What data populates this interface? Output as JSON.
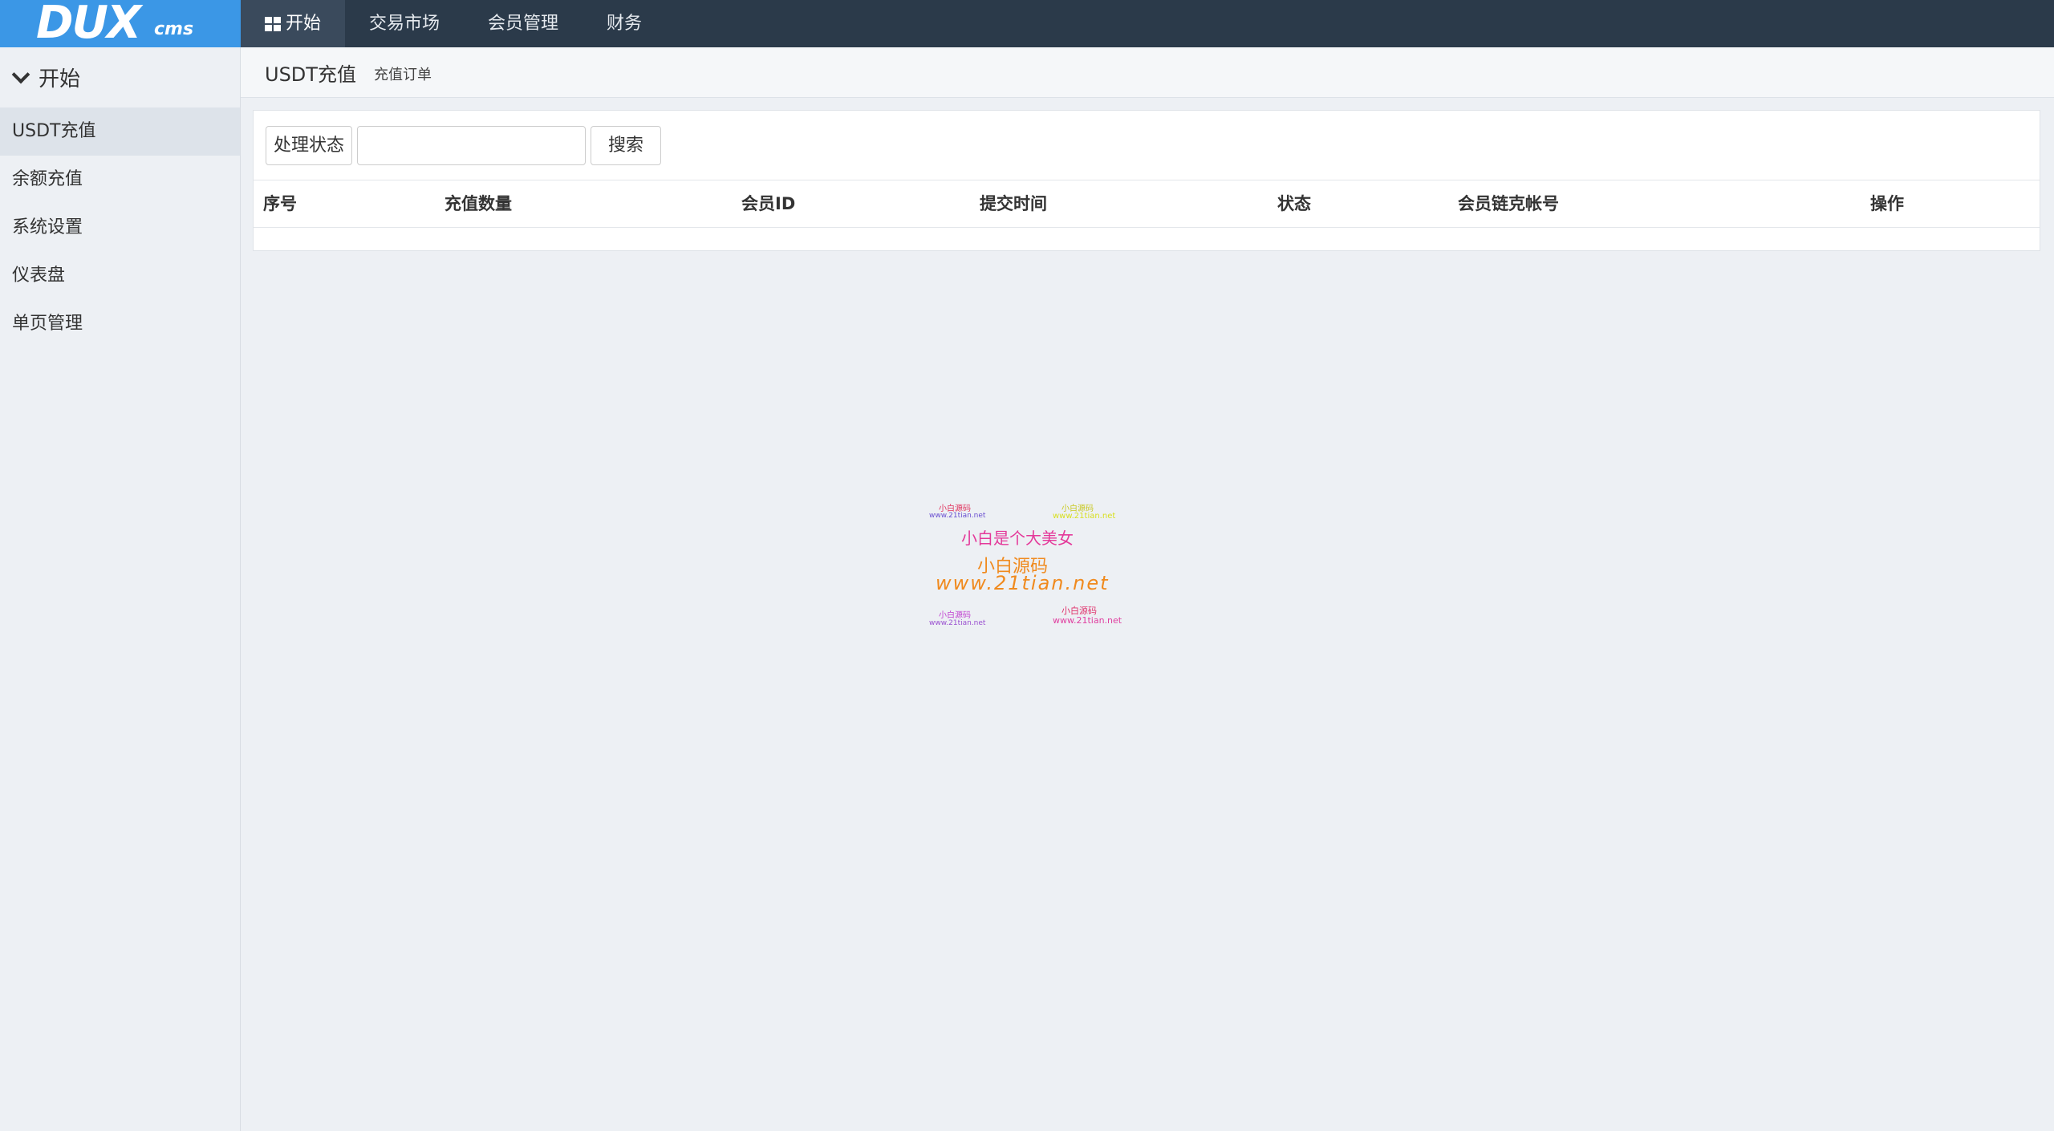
{
  "logo": {
    "main": "DUX",
    "sub": "cms"
  },
  "topnav": [
    {
      "label": "开始",
      "active": true
    },
    {
      "label": "交易市场"
    },
    {
      "label": "会员管理"
    },
    {
      "label": "财务"
    }
  ],
  "sidebar": {
    "heading": "开始",
    "items": [
      {
        "label": "USDT充值",
        "active": true
      },
      {
        "label": "余额充值"
      },
      {
        "label": "系统设置"
      },
      {
        "label": "仪表盘"
      },
      {
        "label": "单页管理"
      }
    ]
  },
  "breadcrumb": {
    "title": "USDT充值",
    "subtitle": "充值订单"
  },
  "filter": {
    "status_label": "处理状态",
    "search_value": "",
    "search_button": "搜索"
  },
  "table": {
    "columns": [
      "序号",
      "充值数量",
      "会员ID",
      "提交时间",
      "状态",
      "会员链克帐号",
      "操作"
    ],
    "rows": []
  },
  "watermark": {
    "small_tl_cn": "小白源码",
    "small_tl_url": "www.21tian.net",
    "small_tr_cn": "小白源码",
    "small_tr_url": "www.21tian.net",
    "line1": "小白是个大美女",
    "line2": "小白源码",
    "line3": "www.21tian.net",
    "small_bl_cn": "小白源码",
    "small_bl_url": "www.21tian.net",
    "small_br_cn": "小白源码",
    "small_br_url": "www.21tian.net"
  },
  "colors": {
    "topbar": "#2b3a4a",
    "logo_bg": "#3b97e6",
    "sidebar_bg": "#edf0f4",
    "watermark_pink": "#e4399a",
    "watermark_orange": "#f08a1e"
  }
}
